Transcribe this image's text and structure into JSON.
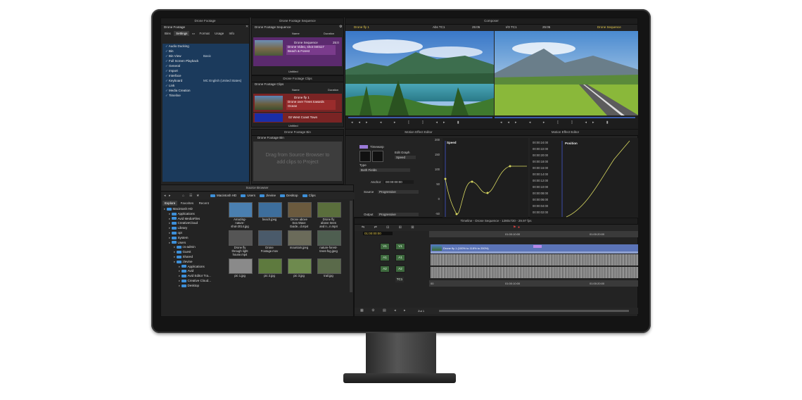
{
  "composer": {
    "title": "Composer",
    "left_clip": "Drone fly 1",
    "left_timecode_label": "Abs TC1",
    "left_timecode": "25:05",
    "right_tc_label": "I/O TC1",
    "right_timecode": "25:05",
    "right_clip": "Drone Sequence"
  },
  "bin_panel": {
    "window_title": "Drone Footage",
    "name": "Drone Footage",
    "tabs": [
      "Bins",
      "Settings",
      "Format",
      "Usage",
      "Info"
    ],
    "active_tab": "Settings",
    "settings": [
      {
        "label": "Audio Ducking",
        "value": ""
      },
      {
        "label": "Bin",
        "value": ""
      },
      {
        "label": "Bin View",
        "value": "Basic"
      },
      {
        "label": "Full Screen Playback",
        "value": ""
      },
      {
        "label": "General",
        "value": ""
      },
      {
        "label": "Import",
        "value": ""
      },
      {
        "label": "Interface",
        "value": ""
      },
      {
        "label": "Keyboard",
        "value": "MC English (United States)"
      },
      {
        "label": "Link",
        "value": ""
      },
      {
        "label": "Media Creation",
        "value": ""
      },
      {
        "label": "Timeline",
        "value": ""
      }
    ]
  },
  "sequence_bin": {
    "window_title": "Drone Footage Sequence",
    "tab": "Drone Footage Sequence",
    "col_name": "Name",
    "col_duration": "Duration",
    "item_name": "Drone Sequence",
    "item_duration": "25:0",
    "item_desc_1": "Drone Video, shot 040117",
    "item_desc_2": "Beach & Forest",
    "footer": "Untitled"
  },
  "clips_bin": {
    "window_title": "Drone Footage Clips",
    "tab": "Drone Footage Clips",
    "col_name": "Name",
    "col_duration": "Duration",
    "item1_name": "Drone fly 1",
    "item1_desc_1": "Drone over Trees towards",
    "item1_desc_2": "Ocean",
    "item2_name": "02 West Coast Town",
    "footer": "Untitled"
  },
  "footage_bin": {
    "window_title": "Drone Footage Bin",
    "tab": "Drone Footage Bin",
    "drop_hint_1": "Drag from Source Browser to",
    "drop_hint_2": "add clips to Project"
  },
  "source_browser": {
    "title": "Source Browser",
    "tabs": [
      "Explore",
      "Favorites",
      "Recent"
    ],
    "path": [
      "Macintosh HD",
      "Users",
      "zlevine",
      "Desktop",
      "Clips"
    ],
    "tree": [
      {
        "label": "Macintosh HD",
        "indent": 0
      },
      {
        "label": "Applications",
        "indent": 1
      },
      {
        "label": "Avid MediaFiles",
        "indent": 1
      },
      {
        "label": "CreativeCloud",
        "indent": 1
      },
      {
        "label": "Library",
        "indent": 1
      },
      {
        "label": "opt",
        "indent": 1
      },
      {
        "label": "System",
        "indent": 1
      },
      {
        "label": "Users",
        "indent": 1
      },
      {
        "label": "cs-admin",
        "indent": 2
      },
      {
        "label": "Guest",
        "indent": 2
      },
      {
        "label": "Shared",
        "indent": 2
      },
      {
        "label": "zlevine",
        "indent": 2
      },
      {
        "label": "Applications",
        "indent": 3
      },
      {
        "label": "Avid",
        "indent": 3
      },
      {
        "label": "Avid Editor Tra...",
        "indent": 3
      },
      {
        "label": "Creative Cloud...",
        "indent": 3
      },
      {
        "label": "Desktop",
        "indent": 3
      }
    ],
    "thumbnails": [
      {
        "label": "Amazing-\nnature-\nshot-2014.jpg",
        "color": "#4a7fb0"
      },
      {
        "label": "beach.jpeg",
        "color": "#3d6e9c"
      },
      {
        "label": "Drone above\nSea Wave\nGuide...d.mp4",
        "color": "#6b5a3e"
      },
      {
        "label": "Drone fly\nabove trees\nand n...n.mp4",
        "color": "#5a6e3c"
      },
      {
        "label": "Drone fly\nthrough light\nhouse.mp4",
        "color": "#555"
      },
      {
        "label": "Drone\nFootage.mov",
        "color": "#4a5a6a"
      },
      {
        "label": "mountain.jpeg",
        "color": "#6b6b5a"
      },
      {
        "label": "nature-forest-\ntrees-fog.jpeg",
        "color": "#4e5e50"
      },
      {
        "label": "pic 1.jpg",
        "color": "#8a8a8a"
      },
      {
        "label": "pic 2.jpg",
        "color": "#5e7a3e"
      },
      {
        "label": "pic 3.jpg",
        "color": "#6e8a4e"
      },
      {
        "label": "trail.jpg",
        "color": "#5a6a4a"
      }
    ]
  },
  "motion_effect": {
    "title_left": "Motion Effect Editor",
    "title_right": "Motion Effect Editor",
    "timewarp_label": "Timewarp",
    "edit_graph_label": "Edit Graph",
    "edit_graph_value": "Speed",
    "type_label": "Type",
    "type_value": "Both Fields",
    "anchor_label": "Anchor",
    "anchor_value": "00:00:00:00",
    "source_label": "Source",
    "source_value": "Progressive",
    "output_label": "Output",
    "output_value": "Progressive",
    "speed_label": "Speed",
    "position_label": "Position",
    "speed_axis": [
      "200",
      "150",
      "100",
      "50",
      "0",
      "-50"
    ],
    "position_axis": [
      "00:00:24:00",
      "00:00:22:00",
      "00:00:20:00",
      "00:00:18:00",
      "00:00:16:00",
      "00:00:14:00",
      "00:00:12:00",
      "00:00:10:00",
      "00:00:08:00",
      "00:00:06:00",
      "00:00:04:00",
      "00:00:02:00"
    ]
  },
  "timeline": {
    "title": "Timeline - Drone Sequence - 1280x720 - 29.97 fps",
    "timecode": "01:00:00:00",
    "ruler_top": [
      "01:00:10:00",
      "01:00:20:00"
    ],
    "ruler_bottom": [
      "00",
      "01:00:10:00",
      "01:00:20:00"
    ],
    "tracks": [
      "V1",
      "V1",
      "A1",
      "A1",
      "A2",
      "A2",
      "TC1"
    ],
    "clip_label": "Drone fly 1 (100% to 118% to 200%)",
    "zoom_label": "Zut 1"
  }
}
